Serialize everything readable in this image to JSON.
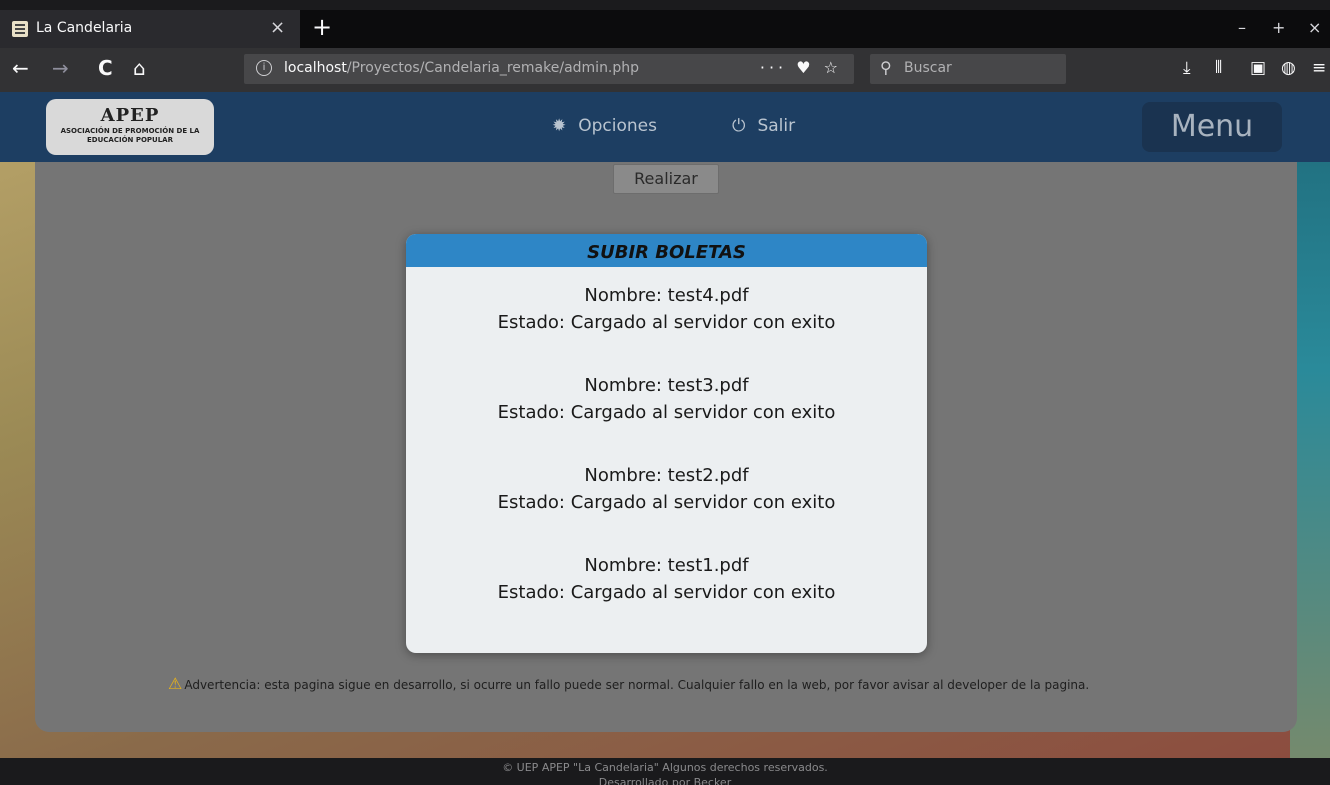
{
  "browser": {
    "tab_title": "La Candelaria",
    "tab_close": "×",
    "new_tab": "+",
    "window_controls": [
      "–",
      "+",
      "×"
    ],
    "nav_buttons": [
      "←",
      "→",
      "C",
      "⌂"
    ],
    "url_host": "localhost",
    "url_path": "/Proyectos/Candelaria_remake/admin.php",
    "url_actions": "··· ♥ ☆",
    "search_placeholder": "Buscar",
    "toolbar_icons": [
      "download-icon",
      "library-icon",
      "sidebar-icon",
      "globe-icon",
      "menu-icon"
    ]
  },
  "site": {
    "logo_brand": "APEP",
    "logo_line1": "ASOCIACIÓN DE PROMOCIÓN DE LA",
    "logo_line2": "EDUCACIÓN POPULAR",
    "nav": [
      {
        "label": "Opciones",
        "icon": "gear-icon"
      },
      {
        "label": "Salir",
        "icon": "power-icon"
      }
    ],
    "menu_label": "Menu",
    "realizar_label": "Realizar",
    "warning_text": "Advertencia: esta pagina sigue en desarrollo, si ocurre un fallo puede ser normal. Cualquier fallo en la web, por favor avisar al developer de la pagina.",
    "footer_line1": "© UEP APEP \"La Candelaria\" Algunos derechos reservados.",
    "footer_line2": "Desarrollado por Becker"
  },
  "modal": {
    "title": "SUBIR BOLETAS",
    "entries": [
      {
        "name": "Nombre: test4.pdf",
        "status": "Estado: Cargado al servidor con exito"
      },
      {
        "name": "Nombre: test3.pdf",
        "status": "Estado: Cargado al servidor con exito"
      },
      {
        "name": "Nombre: test2.pdf",
        "status": "Estado: Cargado al servidor con exito"
      },
      {
        "name": "Nombre: test1.pdf",
        "status": "Estado: Cargado al servidor con exito"
      }
    ]
  }
}
